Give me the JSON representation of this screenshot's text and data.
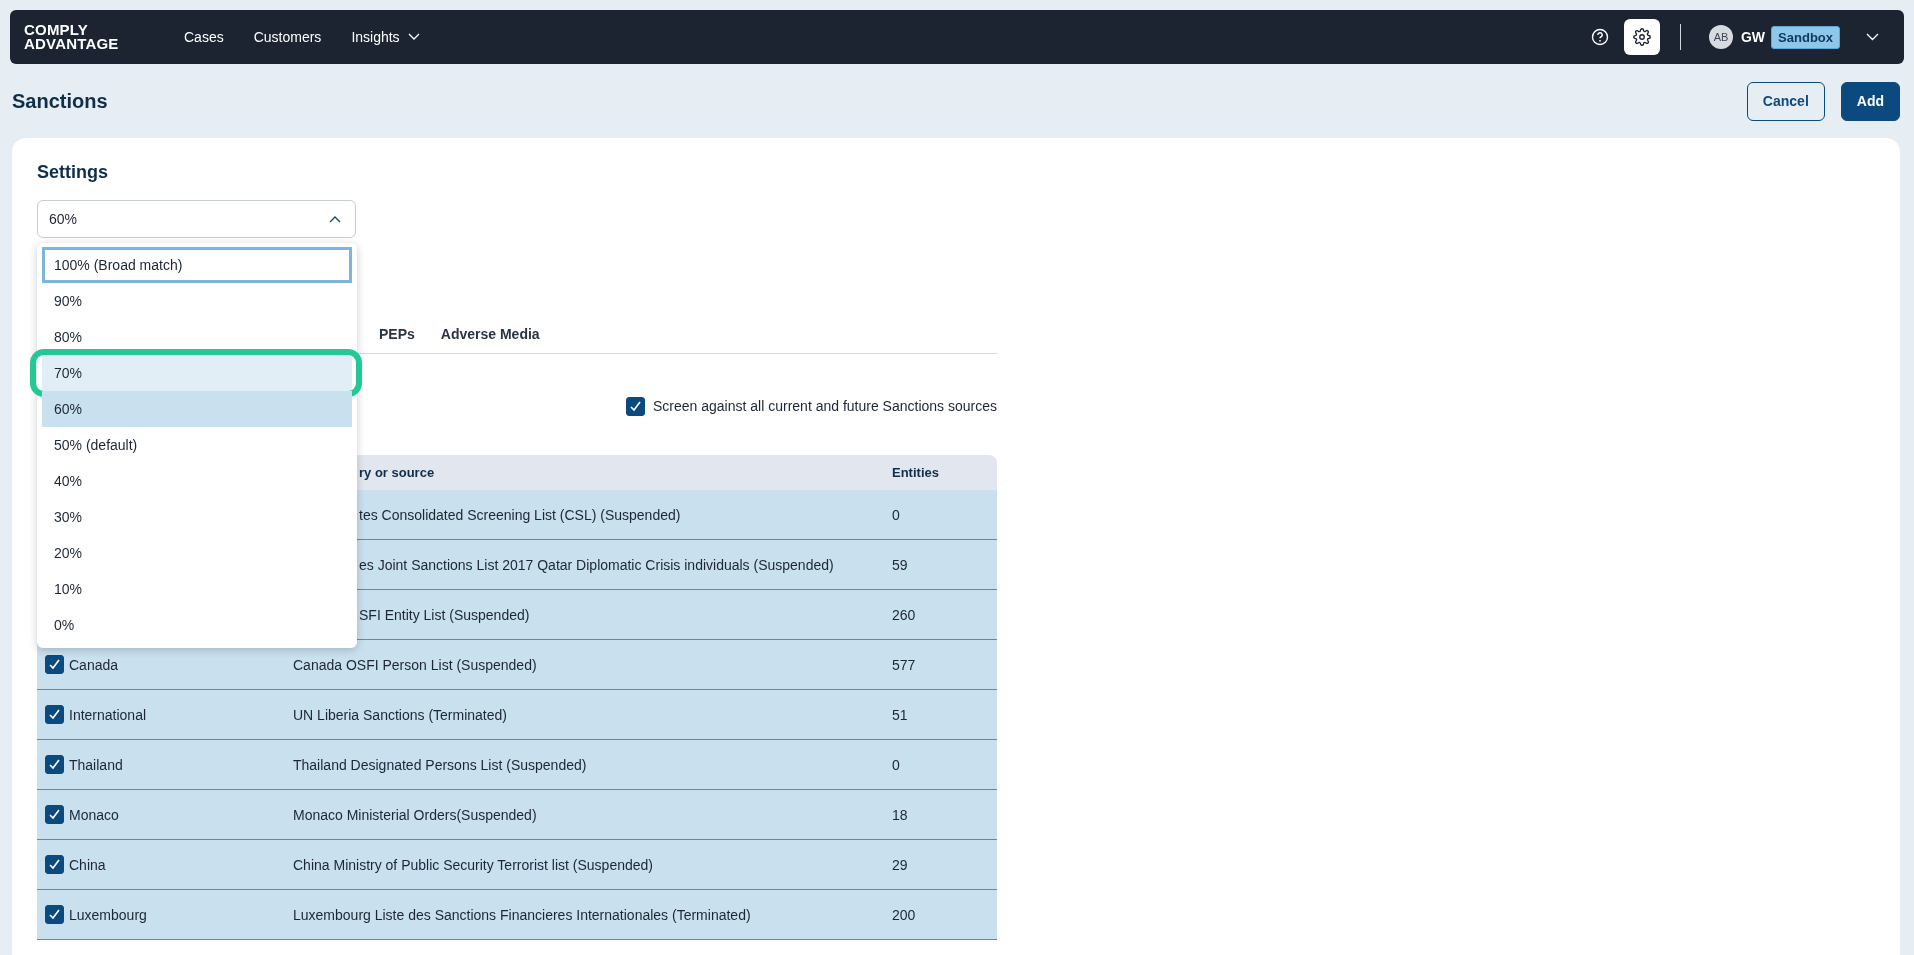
{
  "topbar": {
    "logo_lines": [
      "COMPLY",
      "ADVANTAGE"
    ],
    "nav": [
      {
        "label": "Cases",
        "has_menu": false
      },
      {
        "label": "Customers",
        "has_menu": false
      },
      {
        "label": "Insights",
        "has_menu": true
      }
    ],
    "avatar_initials": "AB",
    "user": "GW",
    "environment": "Sandbox"
  },
  "page": {
    "title": "Sanctions",
    "buttons": [
      {
        "label": "Cancel",
        "kind": "secondary"
      },
      {
        "label": "Add",
        "kind": "primary"
      }
    ]
  },
  "settings": {
    "heading": "Settings",
    "select": {
      "value": "60%",
      "expanded": true,
      "options": [
        {
          "label": "100% (Broad match)",
          "selected": false,
          "focused": true,
          "hovered": false,
          "highlighted": false
        },
        {
          "label": "90%",
          "selected": false,
          "focused": false,
          "hovered": false,
          "highlighted": false
        },
        {
          "label": "80%",
          "selected": false,
          "focused": false,
          "hovered": false,
          "highlighted": false
        },
        {
          "label": "70%",
          "selected": false,
          "focused": false,
          "hovered": true,
          "highlighted": true
        },
        {
          "label": "60%",
          "selected": true,
          "focused": false,
          "hovered": false,
          "highlighted": false
        },
        {
          "label": "50% (default)",
          "selected": false,
          "focused": false,
          "hovered": false,
          "highlighted": false
        },
        {
          "label": "40%",
          "selected": false,
          "focused": false,
          "hovered": false,
          "highlighted": false
        },
        {
          "label": "30%",
          "selected": false,
          "focused": false,
          "hovered": false,
          "highlighted": false
        },
        {
          "label": "20%",
          "selected": false,
          "focused": false,
          "hovered": false,
          "highlighted": false
        },
        {
          "label": "10%",
          "selected": false,
          "focused": false,
          "hovered": false,
          "highlighted": false
        },
        {
          "label": "0%",
          "selected": false,
          "focused": false,
          "hovered": false,
          "highlighted": false
        }
      ]
    }
  },
  "tabs": [
    {
      "label": "PEPs",
      "selected": false
    },
    {
      "label": "Adverse Media",
      "selected": false
    }
  ],
  "screen_all": {
    "label": "Screen against all current and future Sanctions sources",
    "checked": true
  },
  "table": {
    "columns": [
      {
        "label": "ry or source",
        "covered": true
      },
      {
        "label": "Entities",
        "covered": false
      }
    ],
    "rows": [
      {
        "covered": true,
        "source": "tes Consolidated Screening List (CSL) (Suspended)",
        "entities": "0"
      },
      {
        "covered": true,
        "source": "es Joint Sanctions List 2017 Qatar Diplomatic Crisis individuals (Suspended)",
        "entities": "59"
      },
      {
        "covered": true,
        "source": "SFI Entity List (Suspended)",
        "entities": "260"
      },
      {
        "covered": false,
        "checked": true,
        "country": "Canada",
        "source": "Canada OSFI Person List (Suspended)",
        "entities": "577"
      },
      {
        "covered": false,
        "checked": true,
        "country": "International",
        "source": "UN Liberia Sanctions (Terminated)",
        "entities": "51"
      },
      {
        "covered": false,
        "checked": true,
        "country": "Thailand",
        "source": "Thailand Designated Persons List (Suspended)",
        "entities": "0"
      },
      {
        "covered": false,
        "checked": true,
        "country": "Monaco",
        "source": "Monaco Ministerial Orders(Suspended)",
        "entities": "18"
      },
      {
        "covered": false,
        "checked": true,
        "country": "China",
        "source": "China Ministry of Public Security Terrorist list (Suspended)",
        "entities": "29"
      },
      {
        "covered": false,
        "checked": true,
        "country": "Luxembourg",
        "source": "Luxembourg Liste des Sanctions Financieres Internationales (Terminated)",
        "entities": "200"
      }
    ]
  }
}
